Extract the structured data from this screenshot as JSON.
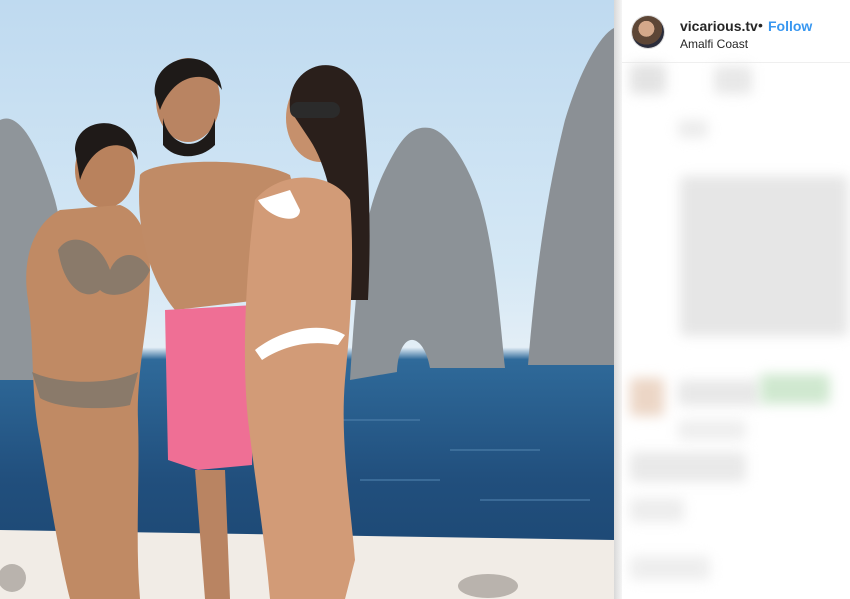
{
  "post": {
    "username": "vicarious.tv",
    "separator": "•",
    "follow_label": "Follow",
    "location": "Amalfi Coast"
  },
  "photo": {
    "subject": "three people posing on a boat in front of sea stack rock formations",
    "colors": {
      "sky": "#cfe3f3",
      "sea": "#244f7a",
      "rock": "#8a9096",
      "boat": "#f2efea",
      "shorts": "#ef6f95"
    }
  },
  "comments": {
    "blurred": true
  },
  "icons": [
    "avatar-icon"
  ]
}
